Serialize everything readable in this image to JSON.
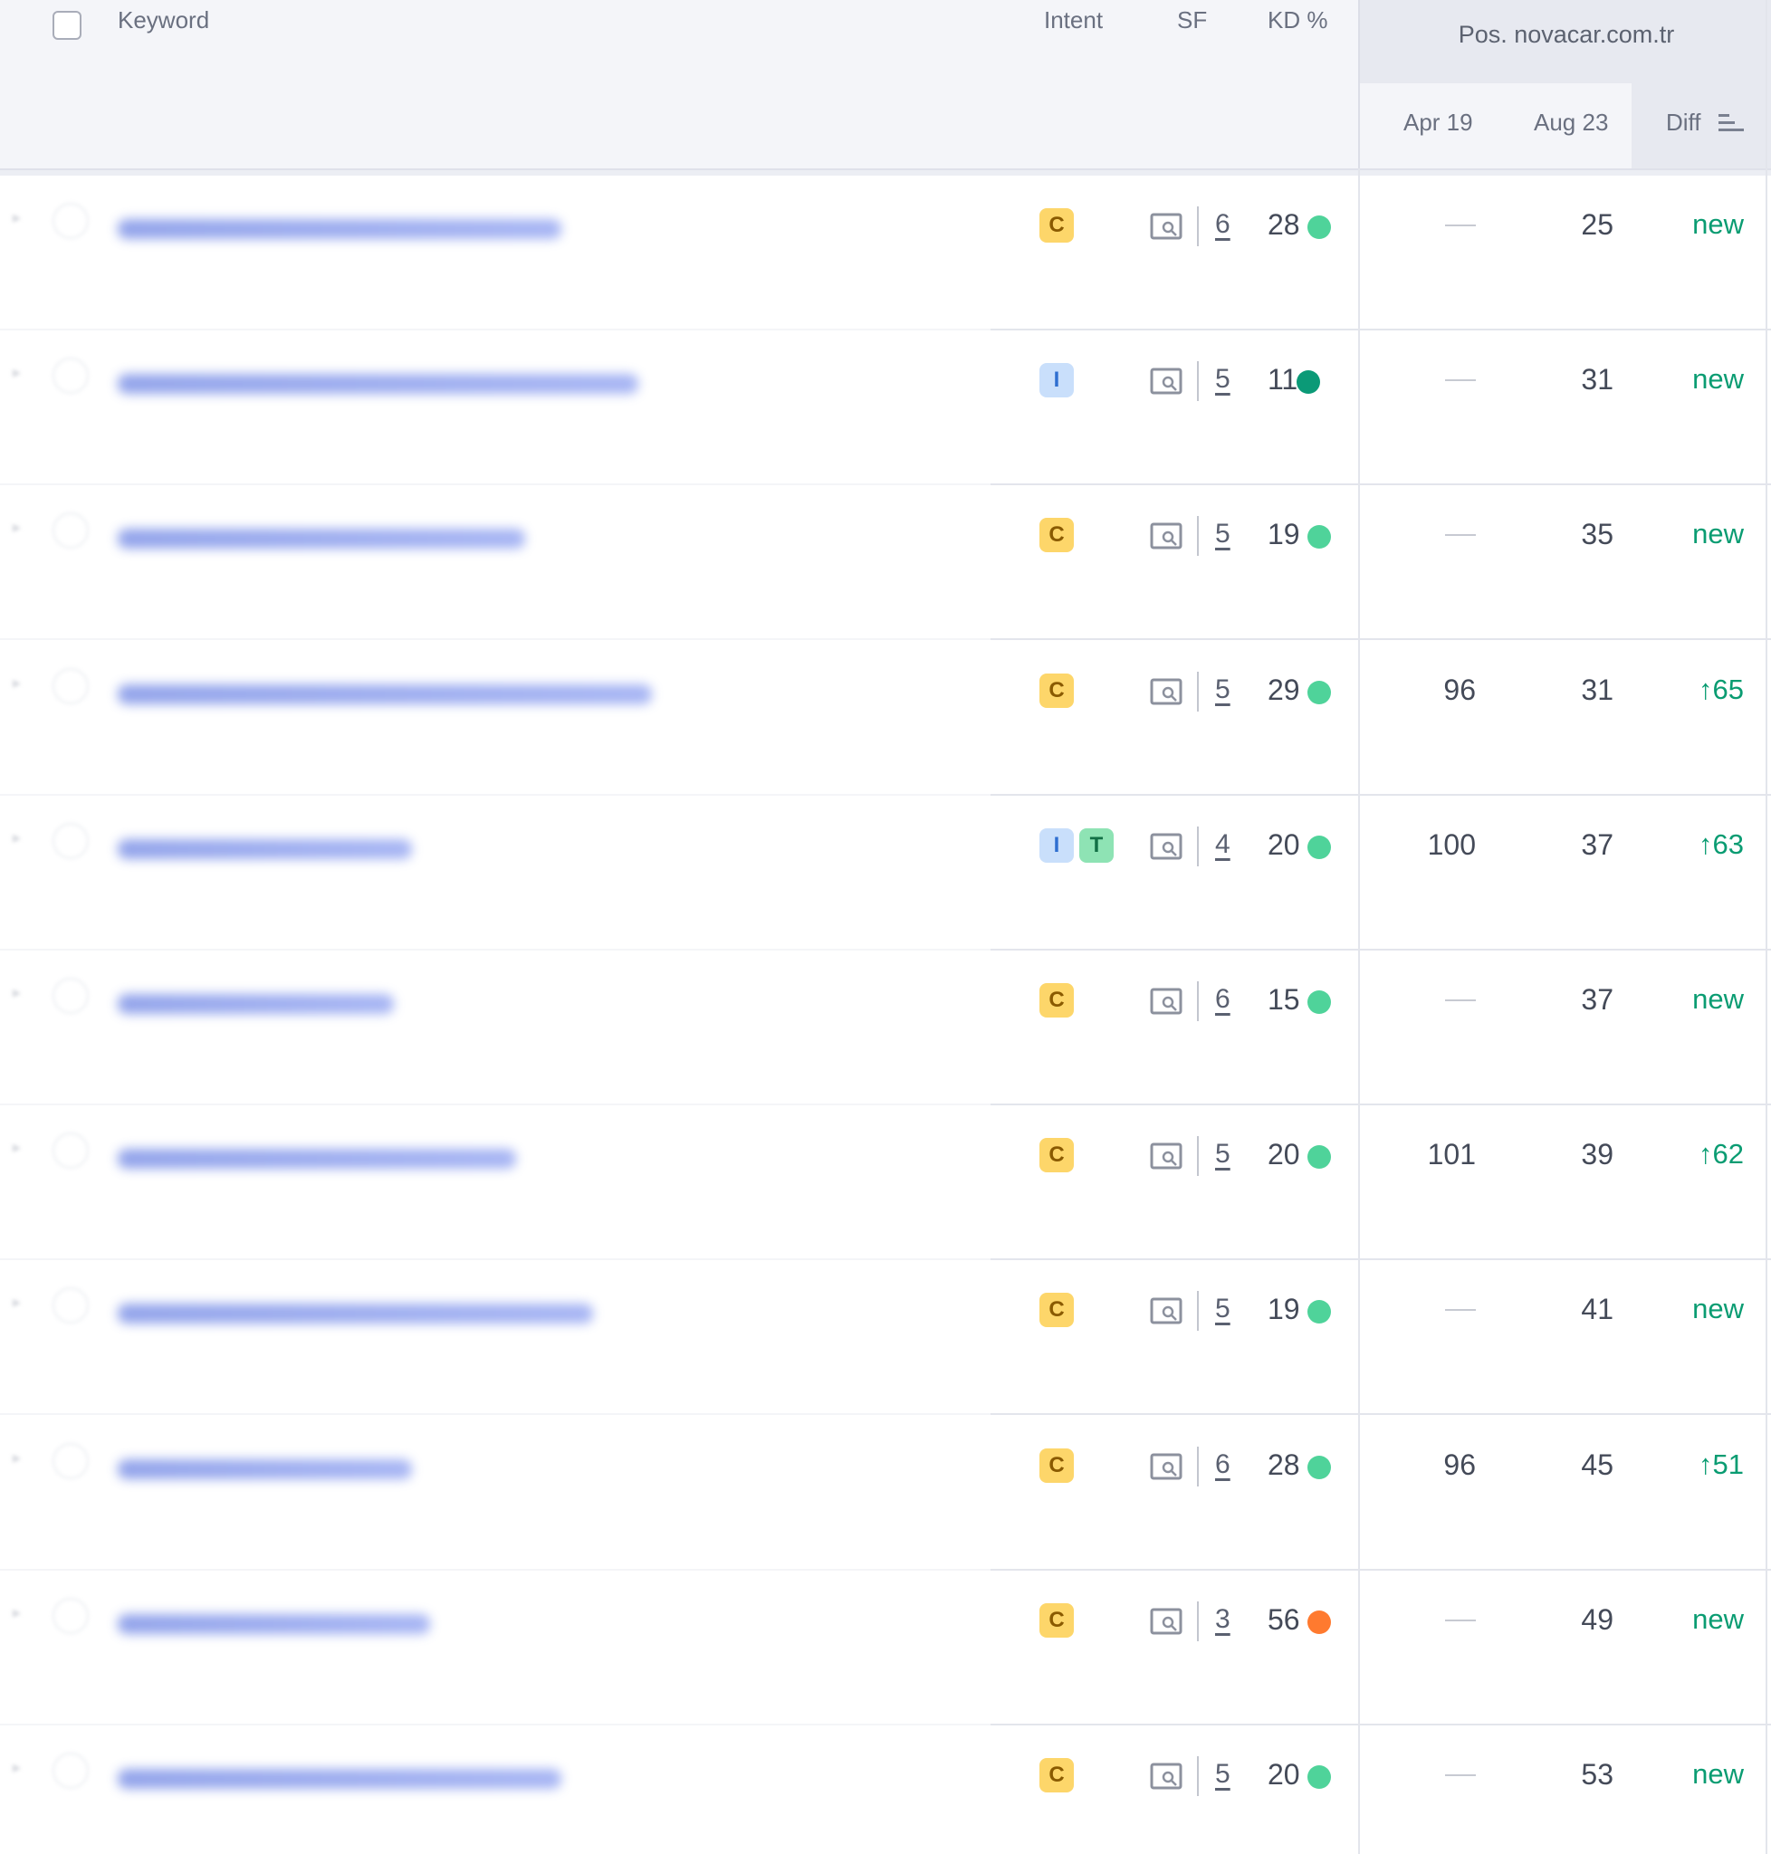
{
  "header": {
    "keyword_label": "Keyword",
    "intent_label": "Intent",
    "sf_label": "SF",
    "kd_label": "KD %",
    "position_group_title": "Pos. novacar.com.tr",
    "date_prev_label": "Apr 19",
    "date_cur_label": "Aug 23",
    "diff_label": "Diff"
  },
  "colors": {
    "kd_easy": "#4fd39a",
    "kd_very_easy": "#0b9a77",
    "kd_difficult": "#ff7a2f",
    "diff_positive": "#0a9c72",
    "keyword_link": "#3d5ad8"
  },
  "rows": [
    {
      "intents": [
        "C"
      ],
      "sf": "6",
      "kd": "28",
      "kd_level": "easy",
      "prev": "",
      "cur": "25",
      "diff": "new"
    },
    {
      "intents": [
        "I"
      ],
      "sf": "5",
      "kd": "11",
      "kd_level": "very_easy",
      "prev": "",
      "cur": "31",
      "diff": "new"
    },
    {
      "intents": [
        "C"
      ],
      "sf": "5",
      "kd": "19",
      "kd_level": "easy",
      "prev": "",
      "cur": "35",
      "diff": "new"
    },
    {
      "intents": [
        "C"
      ],
      "sf": "5",
      "kd": "29",
      "kd_level": "easy",
      "prev": "96",
      "cur": "31",
      "diff": "↑65"
    },
    {
      "intents": [
        "I",
        "T"
      ],
      "sf": "4",
      "kd": "20",
      "kd_level": "easy",
      "prev": "100",
      "cur": "37",
      "diff": "↑63"
    },
    {
      "intents": [
        "C"
      ],
      "sf": "6",
      "kd": "15",
      "kd_level": "easy",
      "prev": "",
      "cur": "37",
      "diff": "new"
    },
    {
      "intents": [
        "C"
      ],
      "sf": "5",
      "kd": "20",
      "kd_level": "easy",
      "prev": "101",
      "cur": "39",
      "diff": "↑62"
    },
    {
      "intents": [
        "C"
      ],
      "sf": "5",
      "kd": "19",
      "kd_level": "easy",
      "prev": "",
      "cur": "41",
      "diff": "new"
    },
    {
      "intents": [
        "C"
      ],
      "sf": "6",
      "kd": "28",
      "kd_level": "easy",
      "prev": "96",
      "cur": "45",
      "diff": "↑51"
    },
    {
      "intents": [
        "C"
      ],
      "sf": "3",
      "kd": "56",
      "kd_level": "difficult",
      "prev": "",
      "cur": "49",
      "diff": "new"
    },
    {
      "intents": [
        "C"
      ],
      "sf": "5",
      "kd": "20",
      "kd_level": "easy",
      "prev": "",
      "cur": "53",
      "diff": "new"
    }
  ]
}
